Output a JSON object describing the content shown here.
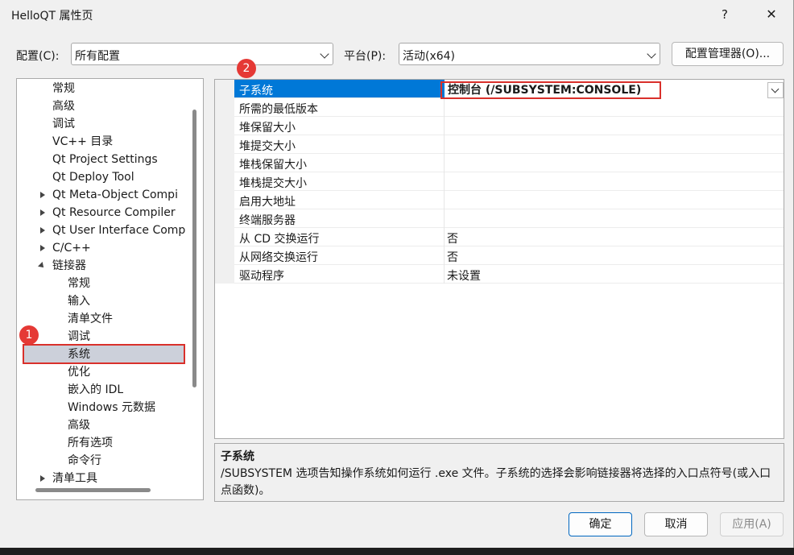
{
  "window": {
    "title": "HelloQT 属性页",
    "help": "?",
    "close": "✕"
  },
  "config": {
    "label": "配置(C):",
    "value": "所有配置"
  },
  "platform": {
    "label": "平台(P):",
    "value": "活动(x64)"
  },
  "config_manager_label": "配置管理器(O)...",
  "tree": [
    {
      "label": "常规",
      "level": 2
    },
    {
      "label": "高级",
      "level": 2
    },
    {
      "label": "调试",
      "level": 2
    },
    {
      "label": "VC++ 目录",
      "level": 2
    },
    {
      "label": "Qt Project Settings",
      "level": 2
    },
    {
      "label": "Qt Deploy Tool",
      "level": 2
    },
    {
      "label": "Qt Meta-Object Compi",
      "level": 2,
      "expander": "collapsed"
    },
    {
      "label": "Qt Resource Compiler",
      "level": 2,
      "expander": "collapsed"
    },
    {
      "label": "Qt User Interface Comp",
      "level": 2,
      "expander": "collapsed"
    },
    {
      "label": "C/C++",
      "level": 2,
      "expander": "collapsed"
    },
    {
      "label": "链接器",
      "level": 2,
      "expander": "expanded"
    },
    {
      "label": "常规",
      "level": 3
    },
    {
      "label": "输入",
      "level": 3
    },
    {
      "label": "清单文件",
      "level": 3
    },
    {
      "label": "调试",
      "level": 3
    },
    {
      "label": "系统",
      "level": 3,
      "selected": true
    },
    {
      "label": "优化",
      "level": 3
    },
    {
      "label": "嵌入的 IDL",
      "level": 3
    },
    {
      "label": "Windows 元数据",
      "level": 3
    },
    {
      "label": "高级",
      "level": 3
    },
    {
      "label": "所有选项",
      "level": 3
    },
    {
      "label": "命令行",
      "level": 3
    },
    {
      "label": "清单工具",
      "level": 2,
      "expander": "collapsed"
    }
  ],
  "properties": [
    {
      "name": "子系统",
      "value": "控制台 (/SUBSYSTEM:CONSOLE)",
      "selected": true
    },
    {
      "name": "所需的最低版本",
      "value": ""
    },
    {
      "name": "堆保留大小",
      "value": ""
    },
    {
      "name": "堆提交大小",
      "value": ""
    },
    {
      "name": "堆栈保留大小",
      "value": ""
    },
    {
      "name": "堆栈提交大小",
      "value": ""
    },
    {
      "name": "启用大地址",
      "value": ""
    },
    {
      "name": "终端服务器",
      "value": ""
    },
    {
      "name": "从 CD 交换运行",
      "value": "否"
    },
    {
      "name": "从网络交换运行",
      "value": "否"
    },
    {
      "name": "驱动程序",
      "value": "未设置"
    }
  ],
  "description": {
    "title": "子系统",
    "text": "/SUBSYSTEM 选项告知操作系统如何运行 .exe 文件。子系统的选择会影响链接器将选择的入口点符号(或入口点函数)。"
  },
  "buttons": {
    "ok": "确定",
    "cancel": "取消",
    "apply": "应用(A)"
  },
  "annotations": {
    "badge1": "1",
    "badge2": "2",
    "color": "#d9302b"
  },
  "colors": {
    "selection": "#0078d7",
    "tree_selection": "#ccd0da"
  }
}
